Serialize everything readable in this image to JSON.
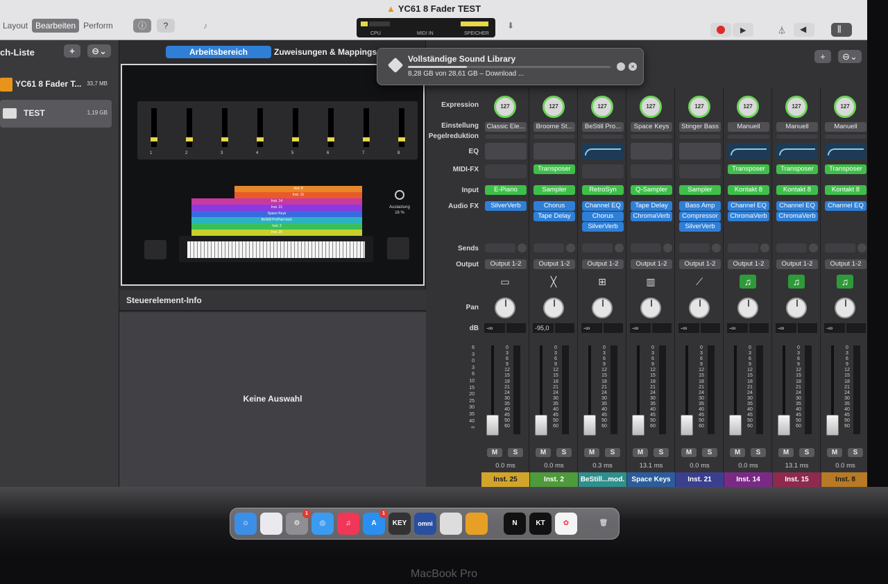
{
  "window": {
    "title": "YC61 8 Fader TEST"
  },
  "toolbar": {
    "modes": [
      "Layout",
      "Bearbeiten",
      "Perform"
    ],
    "active_mode": "Bearbeiten",
    "lcd": {
      "cpu": "CPU",
      "midi": "MIDI IN",
      "mem": "SPEICHER"
    }
  },
  "sidebar": {
    "title": "ch-Liste",
    "patches": [
      {
        "name": "YC61 8 Fader T...",
        "size": "33,7 MB"
      },
      {
        "name": "TEST",
        "size": "1,19 GB"
      }
    ]
  },
  "center": {
    "tab_workspace": "Arbeitsbereich",
    "tab_assign": "Zuweisungen & Mappings",
    "fader_numbers": [
      "1",
      "2",
      "3",
      "4",
      "5",
      "6",
      "7",
      "8"
    ],
    "layers": [
      "Inst. 8",
      "Inst. 15",
      "Inst. 14",
      "Inst. 21",
      "Space Keys",
      "BeStill ProPad mod.",
      "Inst. 2",
      "Inst. 25"
    ],
    "load_label": "Auslastung",
    "load_value": "16 %",
    "info_title": "Steuerelement-Info",
    "info_empty": "Keine Auswahl"
  },
  "popup": {
    "title": "Vollständige Sound Library",
    "progress": 0.29,
    "status": "8,28 GB von 28,61 GB – Download ..."
  },
  "mixer": {
    "row_labels": {
      "expression": "Expression",
      "setting": "Einstellung",
      "gain": "Pegelreduktion",
      "eq": "EQ",
      "midifx": "MIDI-FX",
      "input": "Input",
      "audiofx": "Audio FX",
      "sends": "Sends",
      "output": "Output",
      "pan": "Pan",
      "db": "dB"
    },
    "scale": [
      "0",
      "3",
      "6",
      "9",
      "12",
      "15",
      "18",
      "21",
      "24",
      "30",
      "35",
      "40",
      "45",
      "50",
      "60"
    ],
    "left_scale": [
      "6",
      "3",
      "0",
      "3",
      "6",
      "10",
      "15",
      "20",
      "25",
      "30",
      "35",
      "40",
      "∞"
    ],
    "strips": [
      {
        "expr": "127",
        "setting": "Classic Ele...",
        "eq": false,
        "midifx": "",
        "input": "E-Piano",
        "fx": [
          "SilverVerb"
        ],
        "output": "Output 1-2",
        "icon": "piano",
        "db": "-∞",
        "lat": "0.0 ms",
        "name": "Inst. 25",
        "color": "#d2a52a"
      },
      {
        "expr": "127",
        "setting": "Broome St...",
        "eq": false,
        "midifx": "Transposer",
        "input": "Sampler",
        "fx": [
          "Chorus",
          "Tape Delay"
        ],
        "output": "Output 1-2",
        "icon": "keyboard-stand",
        "db": "-95,0",
        "lat": "0.0 ms",
        "name": "Inst. 2",
        "color": "#4f9a3a"
      },
      {
        "expr": "127",
        "setting": "BeStill Pro...",
        "eq": true,
        "midifx": "",
        "input": "RetroSyn",
        "fx": [
          "Channel EQ",
          "Chorus",
          "SilverVerb"
        ],
        "output": "Output 1-2",
        "icon": "synth",
        "db": "-∞",
        "lat": "0.3 ms",
        "name": "BeStill...mod.",
        "color": "#2f8f8c"
      },
      {
        "expr": "127",
        "setting": "Space Keys",
        "eq": false,
        "midifx": "",
        "input": "Q-Sampler",
        "fx": [
          "Tape Delay",
          "ChromaVerb"
        ],
        "output": "Output 1-2",
        "icon": "keys",
        "db": "-∞",
        "lat": "13.1 ms",
        "name": "Space Keys",
        "color": "#2b5d9a"
      },
      {
        "expr": "127",
        "setting": "Stinger Bass",
        "eq": false,
        "midifx": "",
        "input": "Sampler",
        "fx": [
          "Bass Amp",
          "Compressor",
          "SilverVerb"
        ],
        "output": "Output 1-2",
        "icon": "bass",
        "db": "-∞",
        "lat": "0.0 ms",
        "name": "Inst. 21",
        "color": "#3a3f8e"
      },
      {
        "expr": "127",
        "setting": "Manuell",
        "eq": true,
        "midifx": "Transposer",
        "input": "Kontakt 8",
        "fx": [
          "Channel EQ",
          "ChromaVerb"
        ],
        "output": "Output 1-2",
        "icon": "music-note",
        "db": "-∞",
        "lat": "0.0 ms",
        "name": "Inst. 14",
        "color": "#7a2a86"
      },
      {
        "expr": "127",
        "setting": "Manuell",
        "eq": true,
        "midifx": "Transposer",
        "input": "Kontakt 8",
        "fx": [
          "Channel EQ",
          "ChromaVerb"
        ],
        "output": "Output 1-2",
        "icon": "music-note",
        "db": "-∞",
        "lat": "13.1 ms",
        "name": "Inst. 15",
        "color": "#8e2a4e"
      },
      {
        "expr": "127",
        "setting": "Manuell",
        "eq": true,
        "midifx": "Transposer",
        "input": "Kontakt 8",
        "fx": [
          "Channel EQ"
        ],
        "output": "Output 1-2",
        "icon": "music-note",
        "db": "-∞",
        "lat": "0.0 ms",
        "name": "Inst. 8",
        "color": "#b87a24"
      }
    ],
    "mute": "M",
    "solo": "S"
  },
  "dock": {
    "apps": [
      "Finder",
      "Launchpad",
      "Systemeinstellungen",
      "Safari",
      "Musik",
      "App Store",
      "KEY",
      "omni",
      "Dock-App",
      "MainStage",
      "N",
      "KT",
      "Fotos",
      "Papierkorb"
    ],
    "key_label": "KEY",
    "omni_label": "omni",
    "n_label": "N",
    "kt_label": "KT",
    "badge": "1"
  },
  "laptop": {
    "brand": "MacBook Pro"
  }
}
